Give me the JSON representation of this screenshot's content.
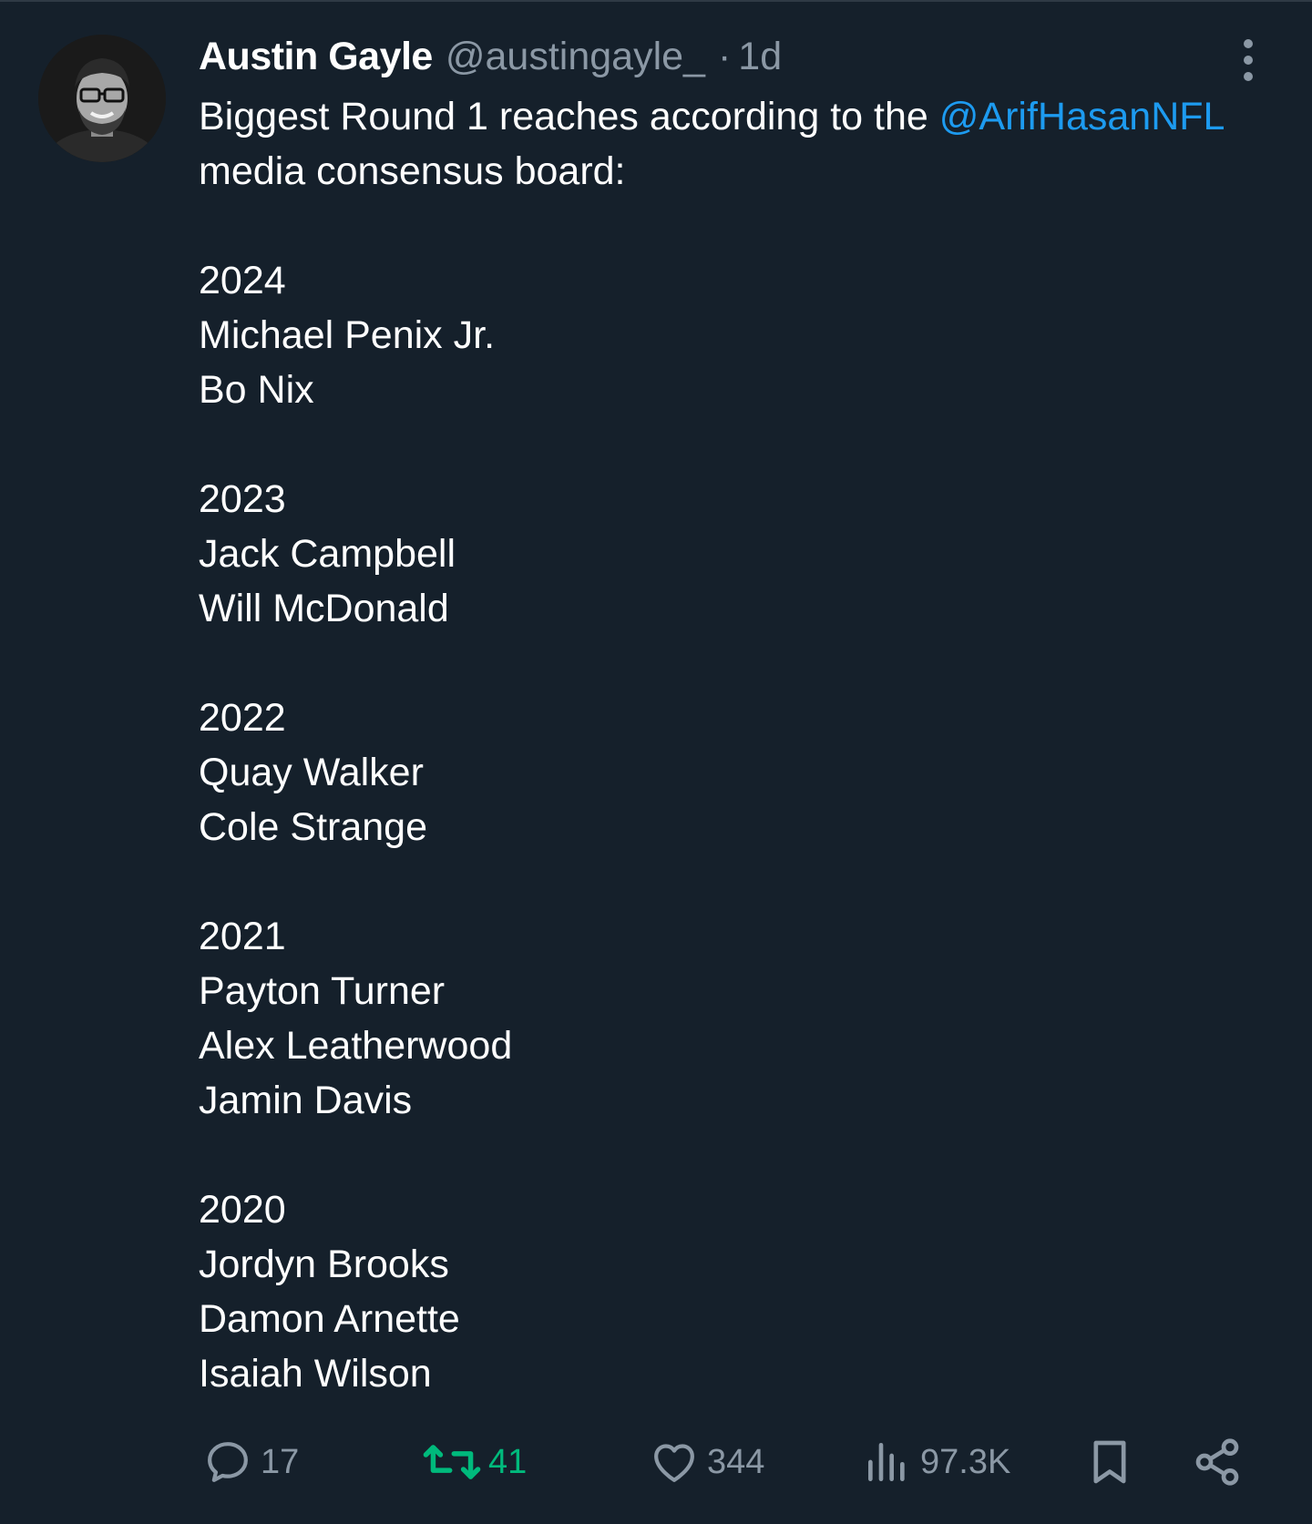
{
  "tweet": {
    "author_name": "Austin Gayle",
    "author_handle": "@austingayle_",
    "separator": "·",
    "time": "1d",
    "text_line1_prefix": "Biggest Round 1 reaches according to the ",
    "mention": "@ArifHasanNFL",
    "text_line2": "media consensus board:",
    "groups": [
      {
        "year": "2024",
        "players": [
          "Michael Penix Jr.",
          "Bo Nix"
        ]
      },
      {
        "year": "2023",
        "players": [
          "Jack Campbell",
          "Will McDonald"
        ]
      },
      {
        "year": "2022",
        "players": [
          "Quay Walker",
          "Cole Strange"
        ]
      },
      {
        "year": "2021",
        "players": [
          "Payton Turner",
          "Alex Leatherwood",
          "Jamin Davis"
        ]
      },
      {
        "year": "2020",
        "players": [
          "Jordyn Brooks",
          "Damon Arnette",
          "Isaiah Wilson"
        ]
      }
    ]
  },
  "actions": {
    "replies": "17",
    "retweets": "41",
    "likes": "344",
    "views": "97.3K"
  },
  "icons": {
    "reply": "reply-icon",
    "retweet": "retweet-icon",
    "like": "heart-icon",
    "views": "views-icon",
    "bookmark": "bookmark-icon",
    "share": "share-icon",
    "more": "more-vertical-icon"
  },
  "colors": {
    "background": "#15202b",
    "text": "#ffffff",
    "muted": "#8b98a5",
    "mention": "#1d9bf0",
    "retweet_active": "#00ba7c"
  }
}
